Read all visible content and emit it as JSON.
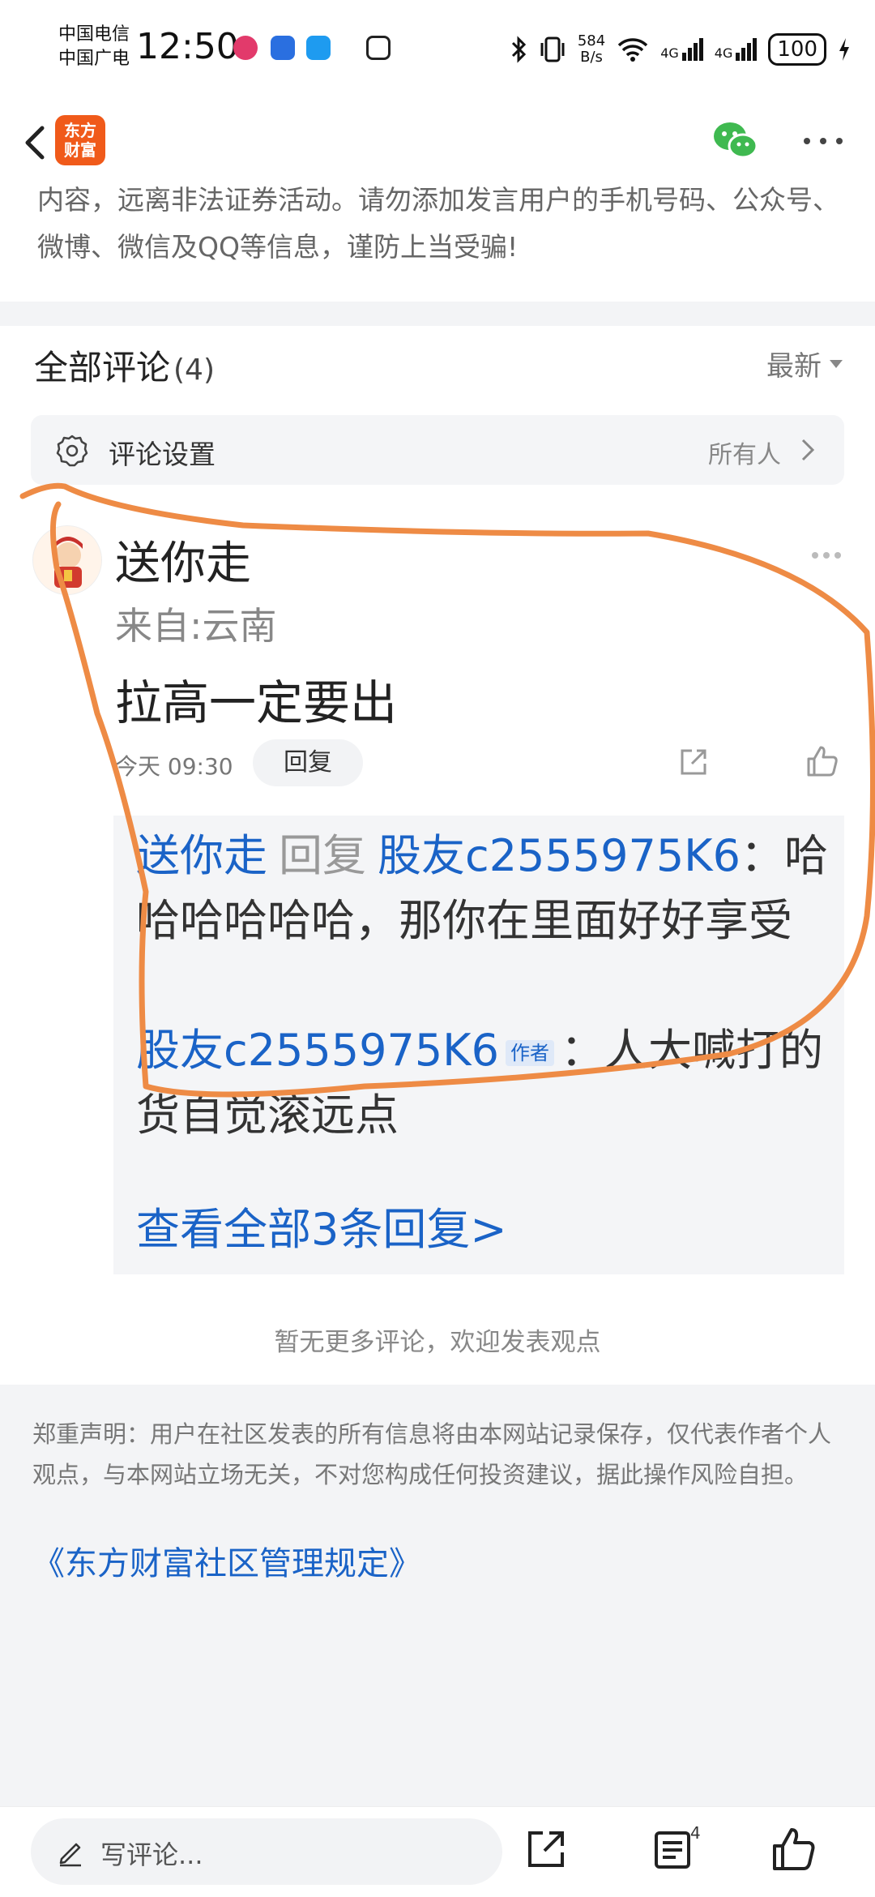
{
  "status_bar": {
    "carrier_1": "中国电信",
    "carrier_2": "中国广电",
    "time": "12:50",
    "net_speed_value": "584",
    "net_speed_unit": "B/s",
    "signal_1": "4G",
    "signal_2": "4G",
    "battery": "100"
  },
  "header": {
    "logo_text_line1": "东方",
    "logo_text_line2": "财富",
    "back_icon": "chevron-left-icon",
    "share_icon": "wechat-icon",
    "more_icon": "more-horizontal-icon"
  },
  "warning": {
    "text": "内容，远离非法证券活动。请勿添加发言用户的手机号码、公众号、微博、微信及QQ等信息，谨防上当受骗!"
  },
  "comments_section": {
    "title": "全部评论",
    "count": "(4)",
    "sort_label": "最新",
    "settings_label": "评论设置",
    "settings_value": "所有人"
  },
  "comment": {
    "username": "送你走",
    "location": "来自:云南",
    "text": "拉高一定要出",
    "time": "今天 09:30",
    "reply_button": "回复",
    "replies": [
      {
        "from": "送你走",
        "verb": "回复",
        "to": "股友c2555975K6",
        "colon": "：",
        "text": "哈哈哈哈哈哈，那你在里面好好享受"
      },
      {
        "from": "股友c2555975K6",
        "tag": "作者",
        "colon": "：",
        "text": "人大喊打的货自觉滚远点"
      }
    ],
    "view_all": "查看全部3条回复>"
  },
  "no_more": "暂无更多评论，欢迎发表观点",
  "disclaimer": {
    "text": "郑重声明：用户在社区发表的所有信息将由本网站记录保存，仅代表作者个人观点，与本网站立场无关，不对您构成任何投资建议，据此操作风险自担。",
    "link": "《东方财富社区管理规定》"
  },
  "bottom_bar": {
    "placeholder": "写评论...",
    "list_badge": "4"
  },
  "colors": {
    "accent_blue": "#1a63c7",
    "brand_orange": "#f05a1a",
    "annotation_orange": "#ee8b45",
    "wechat_green": "#3fb950"
  }
}
